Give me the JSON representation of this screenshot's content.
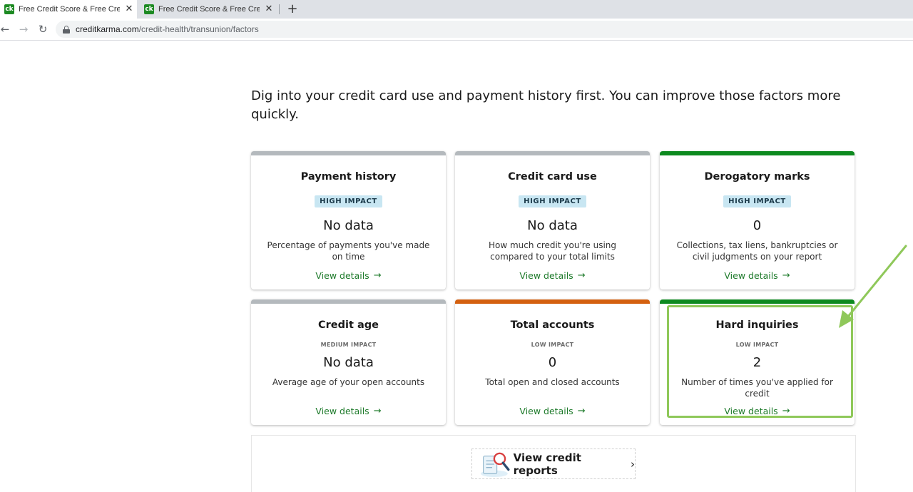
{
  "browser": {
    "tabs": [
      {
        "favicon": "ck",
        "title": "Free Credit Score & Free Credit R",
        "active": true
      },
      {
        "favicon": "ck",
        "title": "Free Credit Score & Free Credit R",
        "active": false
      }
    ],
    "close_glyph": "✕",
    "new_tab_glyph": "+",
    "url_host": "creditkarma.com",
    "url_path": "/credit-health/transunion/factors"
  },
  "page": {
    "intro": "Dig into your credit card use and payment history first. You can improve those factors more quickly.",
    "view_details_label": "View details",
    "cards": [
      {
        "title": "Payment history",
        "impact": "HIGH IMPACT",
        "value": "No data",
        "description": "Percentage of payments you've made on time",
        "bar_color": "#b4b9bd"
      },
      {
        "title": "Credit card use",
        "impact": "HIGH IMPACT",
        "value": "No data",
        "description": "How much credit you're using compared to your total limits",
        "bar_color": "#b4b9bd"
      },
      {
        "title": "Derogatory marks",
        "impact": "HIGH IMPACT",
        "value": "0",
        "description": "Collections, tax liens, bankruptcies or civil judgments on your report",
        "bar_color": "#0d8a1f"
      },
      {
        "title": "Credit age",
        "impact": "MEDIUM IMPACT",
        "value": "No data",
        "description": "Average age of your open accounts",
        "bar_color": "#b4b9bd"
      },
      {
        "title": "Total accounts",
        "impact": "LOW IMPACT",
        "value": "0",
        "description": "Total open and closed accounts",
        "bar_color": "#d4600f"
      },
      {
        "title": "Hard inquiries",
        "impact": "LOW IMPACT",
        "value": "2",
        "description": "Number of times you've applied for credit",
        "bar_color": "#0d8a1f"
      }
    ],
    "reports_button": "View credit reports"
  },
  "colors": {
    "link_green": "#1d7a2a",
    "annotation_green": "#8fc85a",
    "badge_blue": "#c8e6f2"
  }
}
